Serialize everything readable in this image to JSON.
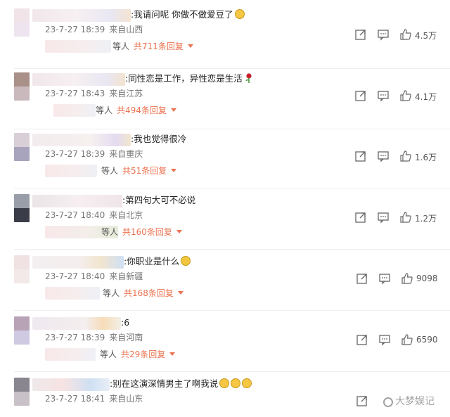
{
  "comments": [
    {
      "text": ":我请问呢 你做不做爱豆了",
      "emoji": "smile",
      "date": "23-7-27 18:39",
      "location": "来自山西",
      "reply_prefix": "等人",
      "reply_link": "共711条回复",
      "likes": "4.5万"
    },
    {
      "text": ":同性恋是工作，异性恋是生活",
      "emoji": "rose",
      "date": "23-7-27 18:43",
      "location": "来自江苏",
      "reply_prefix": "等人",
      "reply_link": "共494条回复",
      "likes": "4.1万"
    },
    {
      "text": ":我也觉得很冷",
      "emoji": "",
      "date": "23-7-27 18:39",
      "location": "来自重庆",
      "reply_prefix": "等人",
      "reply_link": "共51条回复",
      "likes": "1.6万"
    },
    {
      "text": ":第四句大可不必说",
      "emoji": "",
      "date": "23-7-27 18:40",
      "location": "来自北京",
      "reply_prefix": "等人",
      "reply_link": "共160条回复",
      "likes": "1.2万"
    },
    {
      "text": ":你职业是什么",
      "emoji": "laugh-cry",
      "date": "23-7-27 18:40",
      "location": "来自新疆",
      "reply_prefix": "等人",
      "reply_link": "共168条回复",
      "likes": "9098"
    },
    {
      "text": ":6",
      "emoji": "",
      "date": "23-7-27 18:39",
      "location": "来自河南",
      "reply_prefix": "等人",
      "reply_link": "共29条回复",
      "likes": "6590"
    },
    {
      "text": ":别在这演深情男主了啊我说",
      "emoji": "crying-x3",
      "date": "23-7-27 18:41",
      "location": "来自山东",
      "reply_prefix": "",
      "reply_link": "",
      "likes": ""
    }
  ],
  "watermark": "大梦娱记",
  "icons": {
    "share": "share-icon",
    "comment": "comment-icon",
    "like": "like-icon"
  },
  "colors": {
    "reply_link": "#eb7350",
    "meta": "#777777"
  }
}
